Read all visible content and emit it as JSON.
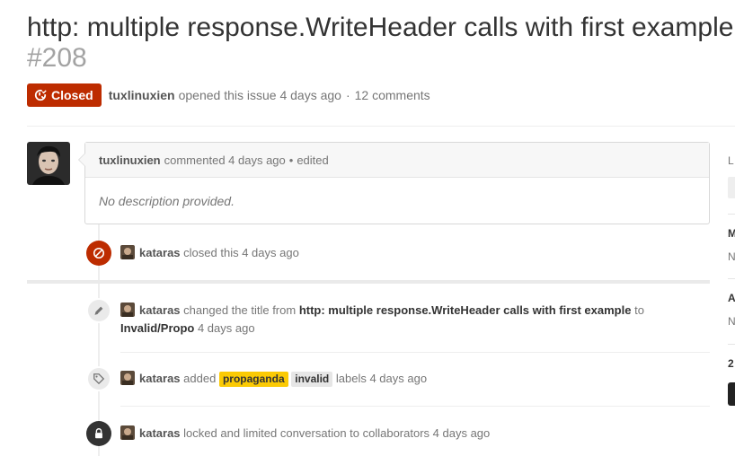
{
  "issue": {
    "title": "http: multiple response.WriteHeader calls with first example",
    "number": "#208",
    "state_label": "Closed",
    "author": "tuxlinuxien",
    "opened_text": "opened this issue 4 days ago",
    "separator": "·",
    "comments_count": "12 comments"
  },
  "comment": {
    "author": "tuxlinuxien",
    "meta": "commented 4 days ago",
    "bullet": "•",
    "edited": "edited",
    "body": "No description provided."
  },
  "events": [
    {
      "actor": "kataras",
      "text": "closed this 4 days ago",
      "icon": "circle-slash-icon"
    },
    {
      "actor": "kataras",
      "text_before": "changed the title from",
      "old_title": "http: multiple response.WriteHeader calls with first example",
      "text_to": "to",
      "new_title": "Invalid/Propo",
      "time": "4 days ago",
      "icon": "pencil-icon"
    },
    {
      "actor": "kataras",
      "text_before": "added",
      "labels": [
        {
          "name": "propaganda",
          "color": "#fbca04"
        },
        {
          "name": "invalid",
          "color": "#e6e6e6"
        }
      ],
      "text_after": "labels 4 days ago",
      "icon": "tag-icon"
    },
    {
      "actor": "kataras",
      "text": "locked and limited conversation to collaborators 4 days ago",
      "icon": "lock-icon"
    }
  ],
  "sidebar": {
    "labels_initial": "L",
    "milestone_initial": "M",
    "milestone_value_initial": "N",
    "assignee_initial": "A",
    "assignee_value_initial": "N",
    "participants_initial": "2"
  },
  "colors": {
    "closed_red": "#bd2c00",
    "label_propaganda": "#fbca04",
    "label_invalid": "#e6e6e6"
  }
}
